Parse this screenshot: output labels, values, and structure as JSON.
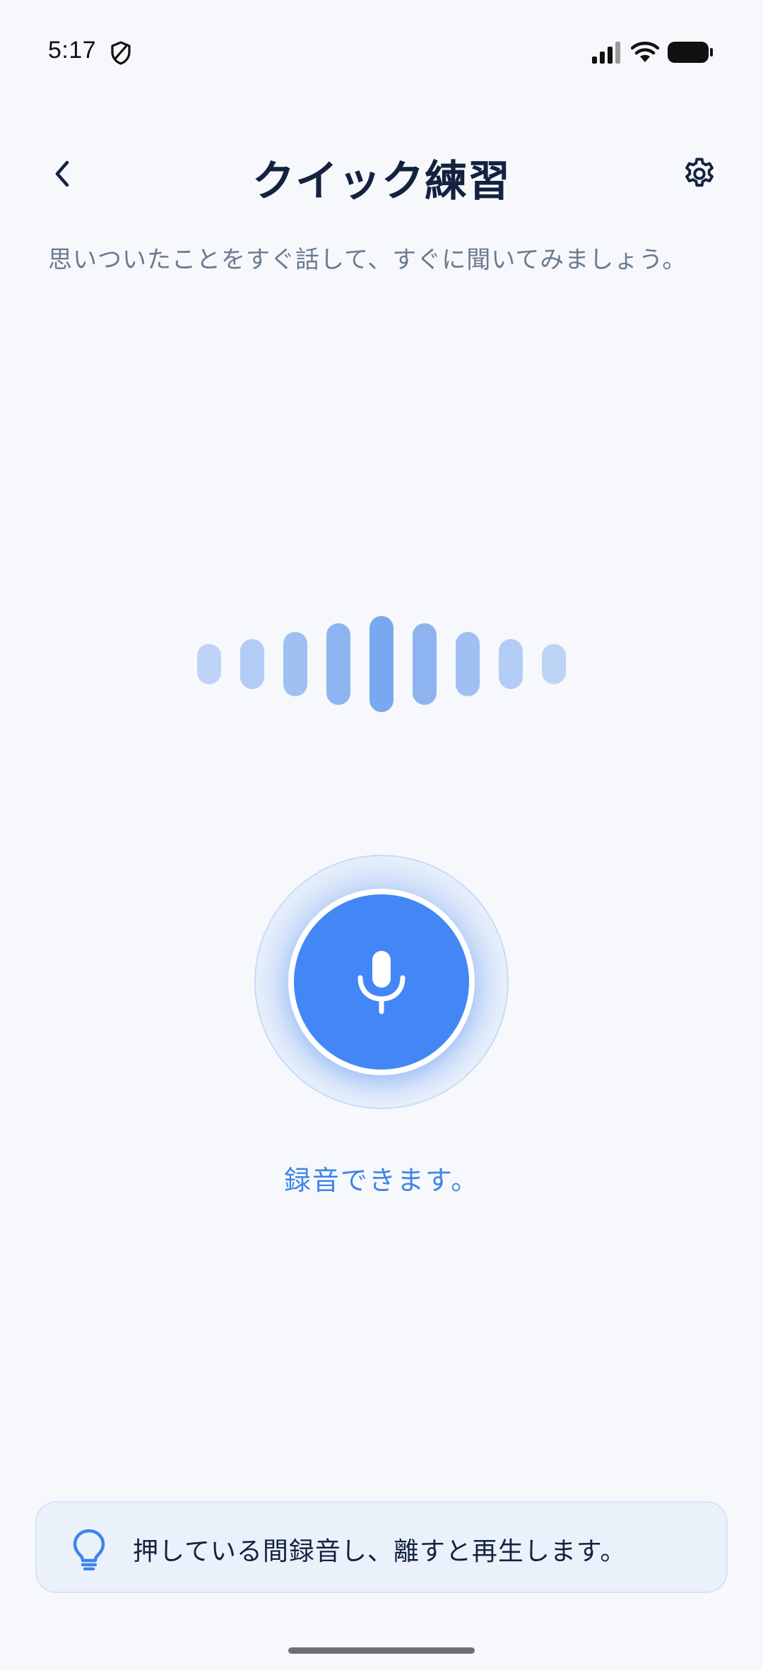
{
  "status_bar": {
    "time": "5:17",
    "icons": [
      "shield-icon",
      "cellular-signal-icon",
      "wifi-icon",
      "battery-icon"
    ]
  },
  "header": {
    "title": "クイック練習",
    "back_icon": "chevron-left-icon",
    "settings_icon": "gear-icon"
  },
  "subtitle": "思いついたことをすぐ話して、すぐに聞いてみましょう。",
  "waveform": {
    "levels": [
      0.42,
      0.52,
      0.67,
      0.85,
      1.0,
      0.85,
      0.67,
      0.52,
      0.42
    ],
    "color": "#7aa8ef"
  },
  "mic": {
    "icon": "microphone-icon",
    "color": "#4287f5"
  },
  "status_label": "録音できます。",
  "tip": {
    "icon": "lightbulb-icon",
    "text": "押している間録音し、離すと再生します。"
  },
  "colors": {
    "background": "#f6f8fc",
    "accent": "#4287f5",
    "title": "#13223f",
    "subtitle": "#6b7a90"
  }
}
